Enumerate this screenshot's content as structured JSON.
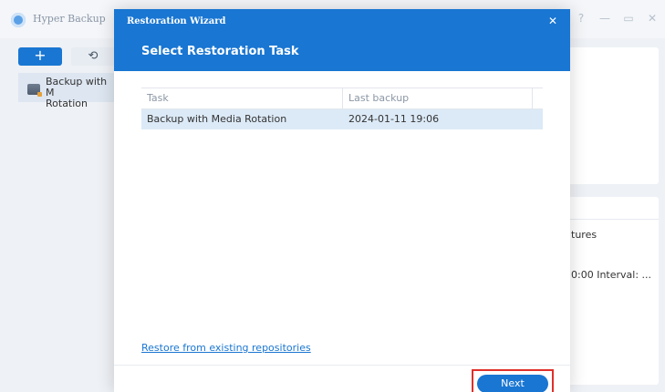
{
  "app": {
    "title": "Hyper Backup",
    "window_controls": [
      "?",
      "—",
      "▭",
      "✕"
    ],
    "toolbar": {
      "add_label": "+",
      "history_label": "⟲"
    },
    "task_list": [
      {
        "label": "Backup with M\nRotation"
      }
    ],
    "right_panel": {
      "text1": "tures",
      "text2": "0:00 Interval: ..."
    }
  },
  "dialog": {
    "title": "Restoration Wizard",
    "close_label": "✕",
    "heading": "Select Restoration Task",
    "table": {
      "headers": [
        "Task",
        "Last backup"
      ],
      "rows": [
        {
          "task": "Backup with Media Rotation",
          "last_backup": "2024-01-11 19:06"
        }
      ]
    },
    "restore_link": "Restore from existing repositories",
    "next_label": "Next"
  },
  "colors": {
    "accent": "#1976d2",
    "highlight_border": "#e0302a",
    "selected_row": "#dceaf7"
  }
}
